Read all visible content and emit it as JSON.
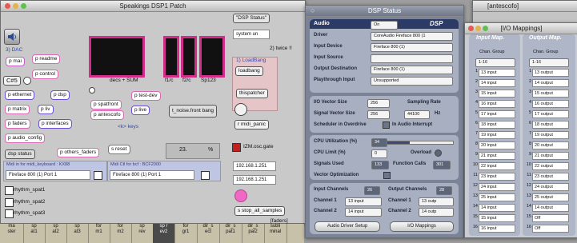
{
  "patch": {
    "title": "Speakings DSP1 Patch",
    "dac_label": "3) DAC",
    "objects": [
      "p mai",
      "p readme",
      "p control",
      "C#5",
      "p ethernet",
      "p dsp",
      "p matrix",
      "p liv",
      "p faders",
      "p interfaces",
      "p audio_config",
      "dsp status",
      "p others_faders",
      "p spatfront",
      "p antescofo",
      "p test-dev",
      "p live",
      "s reset",
      "s stop_all_samples"
    ],
    "messages": [
      "t_noise.front bang",
      "loadbang",
      "thispatcher",
      "r midi_panic"
    ],
    "meter_labels": [
      "decs + SUM",
      "f1/c",
      "f2/c",
      "Sp123"
    ],
    "keys_label": "<k> keys",
    "system_dropdown": "system un",
    "dsp_status_msg": "\"DSP Status\"",
    "twice_label": "2) twice !!",
    "loadbang_label": "1) LoadBang",
    "number_box": "23.",
    "percent": "%",
    "osc_label": "IZM.osc.gate",
    "ip1": "192.168.1.251",
    "ip2": "192.168.1.251",
    "midi_panel_1_label": "Midi in for midi_keyboard : KX88",
    "midi_panel_1_value": "Fireface 800 (1) Port 1",
    "midi_panel_2_label": "Midi Ctl for bcf : BCF2000",
    "midi_panel_2_value": "Fireface 800 (1) Port 1",
    "rhythm": [
      "rhythm_spat1",
      "rhythm_spat2",
      "rhythm_spat3"
    ],
    "faders_label": "[faders]"
  },
  "antescofo_title": "[antescofo]",
  "keyboard_keys": [
    {
      "top": "ma",
      "bot": "ster"
    },
    {
      "top": "sp",
      "bot": "at1"
    },
    {
      "top": "sp",
      "bot": "at2"
    },
    {
      "top": "sp",
      "bot": "at3"
    },
    {
      "top": "for",
      "bot": "m1"
    },
    {
      "top": "for",
      "bot": "m2"
    },
    {
      "top": "sp",
      "bot": "rev"
    },
    {
      "top": "sp r",
      "bot": "ev2"
    },
    {
      "top": "for",
      "bot": "gr1"
    },
    {
      "top": "dir_s",
      "bot": "ect"
    },
    {
      "top": "dir_s",
      "bot": "pat1"
    },
    {
      "top": "dir_s",
      "bot": "pal2"
    },
    {
      "top": "subli",
      "bot": "minal"
    }
  ],
  "dsp": {
    "title": "DSP Status",
    "header_left": "Audio",
    "header_toggle": "On",
    "header_right": "DSP",
    "driver_label": "Driver",
    "driver_value": "CoreAudio Fireface 800 (1",
    "input_device_label": "Input Device",
    "input_device_value": "Fireface 800 (1)",
    "input_source_label": "Input Source",
    "output_device_label": "Output Destination",
    "output_device_value": "Fireface 800 (1)",
    "playthrough_label": "Playthrough Input",
    "playthrough_value": "Unsupported",
    "io_vector_label": "I/O Vector Size",
    "io_vector_value": "256",
    "sampling_label": "Sampling Rate",
    "signal_vector_label": "Signal Vector Size",
    "signal_vector_value": "256",
    "sampling_value": "44100",
    "hz": "Hz",
    "scheduler_label": "Scheduler in Overdrive",
    "interrupt_label": "In Audio Interrupt",
    "cpu_util_label": "CPU Utilization (%)",
    "cpu_util_value": "34",
    "cpu_util_fraction": 0.34,
    "cpu_limit_label": "CPU Limit (%)",
    "cpu_limit_value": "0",
    "overload_label": "Overload",
    "signals_label": "Signals Used",
    "signals_value": "133",
    "function_label": "Function Calls",
    "function_value": "301",
    "vector_opt_label": "Vector Optimization",
    "input_ch_label": "Input Channels",
    "input_ch_value": "26",
    "output_ch_label": "Output Channels",
    "output_ch_value": "28",
    "ch1_label": "Channel 1",
    "ch1_in": "13 input",
    "ch1_out": "13 outp",
    "ch2_label": "Channel 2",
    "ch2_in": "14 input",
    "ch2_out": "14 outp",
    "btn_setup": "Audio Driver Setup",
    "btn_io": "I/O Mappings"
  },
  "io": {
    "title": "[I/O Mappings]",
    "input_head": "Input Map.",
    "output_head": "Output Map.",
    "chan_group": "Chan. Group",
    "group_value": "1-16",
    "inputs": [
      "13 input",
      "14 input",
      "15 input",
      "16 input",
      "17 input",
      "18 input",
      "19 input",
      "20 input",
      "21 input",
      "22 input",
      "23 input",
      "24 input",
      "25 input",
      "14 input",
      "15 input",
      "16 input"
    ],
    "outputs": [
      "13 output",
      "14 output",
      "15 output",
      "16 output",
      "17 output",
      "18 output",
      "19 output",
      "20 output",
      "21 output",
      "22 output",
      "23 output",
      "24 output",
      "25 output",
      "14 output",
      "Off",
      "Off"
    ]
  },
  "colors": {
    "dsp_bg": "#7b8496",
    "dsp_accent": "#2c3a66",
    "meter_border": "#d22d8a",
    "selected_key": "#4a4a4a"
  }
}
